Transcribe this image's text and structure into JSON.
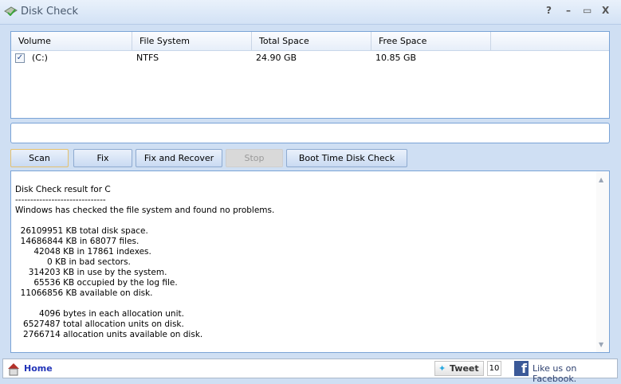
{
  "window": {
    "title": "Disk Check",
    "help": "?",
    "minimize": "–",
    "maximize": "▭",
    "close": "X"
  },
  "volumes": {
    "columns": [
      "Volume",
      "File System",
      "Total Space",
      "Free Space"
    ],
    "rows": [
      {
        "checked": true,
        "volume": "(C:)",
        "file_system": "NTFS",
        "total": "24.90 GB",
        "free": "10.85 GB"
      }
    ]
  },
  "buttons": {
    "scan": "Scan",
    "fix": "Fix",
    "fix_recover": "Fix and Recover",
    "stop": "Stop",
    "boot": "Boot Time Disk Check"
  },
  "output": "Disk Check result for C\n------------------------------\nWindows has checked the file system and found no problems.\n\n  26109951 KB total disk space.\n  14686844 KB in 68077 files.\n       42048 KB in 17861 indexes.\n            0 KB in bad sectors.\n     314203 KB in use by the system.\n       65536 KB occupied by the log file.\n  11066856 KB available on disk.\n\n         4096 bytes in each allocation unit.\n   6527487 total allocation units on disk.\n   2766714 allocation units available on disk.",
  "status": {
    "home": "Home",
    "tweet": "Tweet",
    "tweet_count": "10",
    "facebook": "Like us on Facebook."
  }
}
